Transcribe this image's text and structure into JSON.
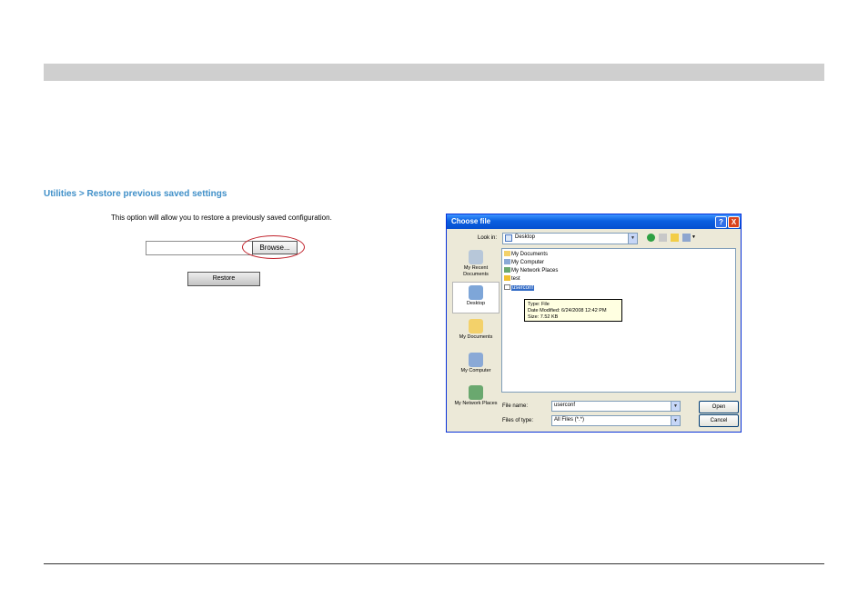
{
  "page": {
    "section_title": "Utilities > Restore previous saved settings",
    "intro": "This option will allow you to restore a previously saved configuration.",
    "file_input_value": "",
    "browse_label": "Browse...",
    "restore_label": "Restore"
  },
  "dialog": {
    "title": "Choose file",
    "help_label": "?",
    "close_label": "X",
    "look_in_label": "Look in:",
    "look_in_value": "Desktop",
    "places": [
      {
        "label": "My Recent Documents"
      },
      {
        "label": "Desktop"
      },
      {
        "label": "My Documents"
      },
      {
        "label": "My Computer"
      },
      {
        "label": "My Network Places"
      }
    ],
    "files": [
      {
        "name": "My Documents"
      },
      {
        "name": "My Computer"
      },
      {
        "name": "My Network Places"
      },
      {
        "name": "test"
      },
      {
        "name": "userconf"
      }
    ],
    "tooltip": {
      "type": "Type: File",
      "modified": "Date Modified: 6/24/2008 12:42 PM",
      "size": "Size: 7.52 KB"
    },
    "file_name_label": "File name:",
    "file_name_value": "userconf",
    "files_of_type_label": "Files of type:",
    "files_of_type_value": "All Files (*.*)",
    "open_label": "Open",
    "cancel_label": "Cancel"
  },
  "colors": {
    "title_blue": "#3f8fc8",
    "highlight_ring": "#c0202a",
    "xp_title": "#0a5fe0"
  }
}
